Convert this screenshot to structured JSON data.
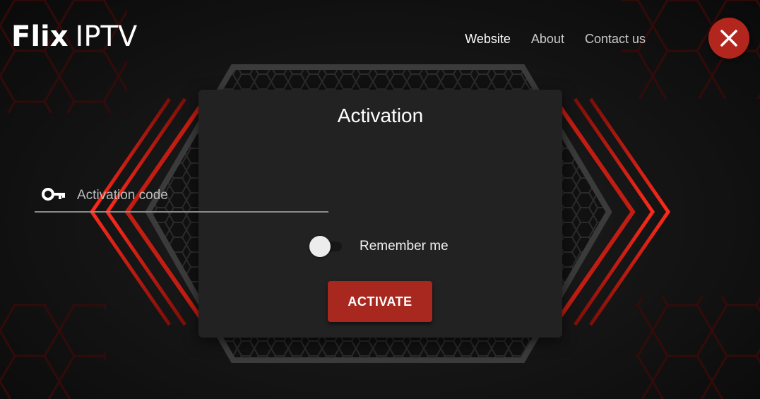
{
  "header": {
    "logo_bold": "Flix",
    "logo_light": "IPTV",
    "nav": [
      {
        "label": "Website",
        "active": true
      },
      {
        "label": "About",
        "active": false
      },
      {
        "label": "Contact us",
        "active": false
      }
    ],
    "close_icon": "close-icon"
  },
  "activation": {
    "title": "Activation",
    "code_placeholder": "Activation code",
    "code_value": "",
    "key_icon": "key-icon",
    "remember_label": "Remember me",
    "remember_checked": false,
    "button_label": "ACTIVATE"
  },
  "theme": {
    "accent": "#b3261e",
    "button": "#a8281f",
    "card": "#232223",
    "background": "#0d0d0d"
  }
}
